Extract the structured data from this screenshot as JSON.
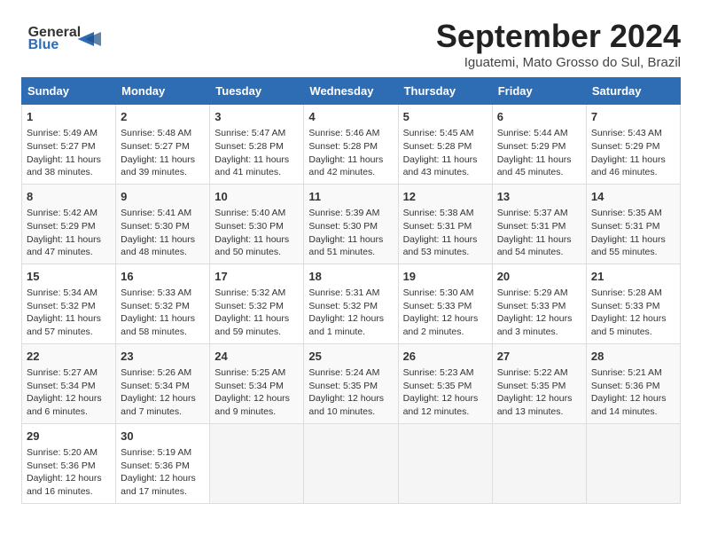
{
  "header": {
    "logo_line1": "General",
    "logo_line2": "Blue",
    "month": "September 2024",
    "location": "Iguatemi, Mato Grosso do Sul, Brazil"
  },
  "weekdays": [
    "Sunday",
    "Monday",
    "Tuesday",
    "Wednesday",
    "Thursday",
    "Friday",
    "Saturday"
  ],
  "weeks": [
    [
      {
        "day": "1",
        "sunrise": "5:49 AM",
        "sunset": "5:27 PM",
        "daylight": "11 hours and 38 minutes."
      },
      {
        "day": "2",
        "sunrise": "5:48 AM",
        "sunset": "5:27 PM",
        "daylight": "11 hours and 39 minutes."
      },
      {
        "day": "3",
        "sunrise": "5:47 AM",
        "sunset": "5:28 PM",
        "daylight": "11 hours and 41 minutes."
      },
      {
        "day": "4",
        "sunrise": "5:46 AM",
        "sunset": "5:28 PM",
        "daylight": "11 hours and 42 minutes."
      },
      {
        "day": "5",
        "sunrise": "5:45 AM",
        "sunset": "5:28 PM",
        "daylight": "11 hours and 43 minutes."
      },
      {
        "day": "6",
        "sunrise": "5:44 AM",
        "sunset": "5:29 PM",
        "daylight": "11 hours and 45 minutes."
      },
      {
        "day": "7",
        "sunrise": "5:43 AM",
        "sunset": "5:29 PM",
        "daylight": "11 hours and 46 minutes."
      }
    ],
    [
      {
        "day": "8",
        "sunrise": "5:42 AM",
        "sunset": "5:29 PM",
        "daylight": "11 hours and 47 minutes."
      },
      {
        "day": "9",
        "sunrise": "5:41 AM",
        "sunset": "5:30 PM",
        "daylight": "11 hours and 48 minutes."
      },
      {
        "day": "10",
        "sunrise": "5:40 AM",
        "sunset": "5:30 PM",
        "daylight": "11 hours and 50 minutes."
      },
      {
        "day": "11",
        "sunrise": "5:39 AM",
        "sunset": "5:30 PM",
        "daylight": "11 hours and 51 minutes."
      },
      {
        "day": "12",
        "sunrise": "5:38 AM",
        "sunset": "5:31 PM",
        "daylight": "11 hours and 53 minutes."
      },
      {
        "day": "13",
        "sunrise": "5:37 AM",
        "sunset": "5:31 PM",
        "daylight": "11 hours and 54 minutes."
      },
      {
        "day": "14",
        "sunrise": "5:35 AM",
        "sunset": "5:31 PM",
        "daylight": "11 hours and 55 minutes."
      }
    ],
    [
      {
        "day": "15",
        "sunrise": "5:34 AM",
        "sunset": "5:32 PM",
        "daylight": "11 hours and 57 minutes."
      },
      {
        "day": "16",
        "sunrise": "5:33 AM",
        "sunset": "5:32 PM",
        "daylight": "11 hours and 58 minutes."
      },
      {
        "day": "17",
        "sunrise": "5:32 AM",
        "sunset": "5:32 PM",
        "daylight": "11 hours and 59 minutes."
      },
      {
        "day": "18",
        "sunrise": "5:31 AM",
        "sunset": "5:32 PM",
        "daylight": "12 hours and 1 minute."
      },
      {
        "day": "19",
        "sunrise": "5:30 AM",
        "sunset": "5:33 PM",
        "daylight": "12 hours and 2 minutes."
      },
      {
        "day": "20",
        "sunrise": "5:29 AM",
        "sunset": "5:33 PM",
        "daylight": "12 hours and 3 minutes."
      },
      {
        "day": "21",
        "sunrise": "5:28 AM",
        "sunset": "5:33 PM",
        "daylight": "12 hours and 5 minutes."
      }
    ],
    [
      {
        "day": "22",
        "sunrise": "5:27 AM",
        "sunset": "5:34 PM",
        "daylight": "12 hours and 6 minutes."
      },
      {
        "day": "23",
        "sunrise": "5:26 AM",
        "sunset": "5:34 PM",
        "daylight": "12 hours and 7 minutes."
      },
      {
        "day": "24",
        "sunrise": "5:25 AM",
        "sunset": "5:34 PM",
        "daylight": "12 hours and 9 minutes."
      },
      {
        "day": "25",
        "sunrise": "5:24 AM",
        "sunset": "5:35 PM",
        "daylight": "12 hours and 10 minutes."
      },
      {
        "day": "26",
        "sunrise": "5:23 AM",
        "sunset": "5:35 PM",
        "daylight": "12 hours and 12 minutes."
      },
      {
        "day": "27",
        "sunrise": "5:22 AM",
        "sunset": "5:35 PM",
        "daylight": "12 hours and 13 minutes."
      },
      {
        "day": "28",
        "sunrise": "5:21 AM",
        "sunset": "5:36 PM",
        "daylight": "12 hours and 14 minutes."
      }
    ],
    [
      {
        "day": "29",
        "sunrise": "5:20 AM",
        "sunset": "5:36 PM",
        "daylight": "12 hours and 16 minutes."
      },
      {
        "day": "30",
        "sunrise": "5:19 AM",
        "sunset": "5:36 PM",
        "daylight": "12 hours and 17 minutes."
      },
      null,
      null,
      null,
      null,
      null
    ]
  ]
}
